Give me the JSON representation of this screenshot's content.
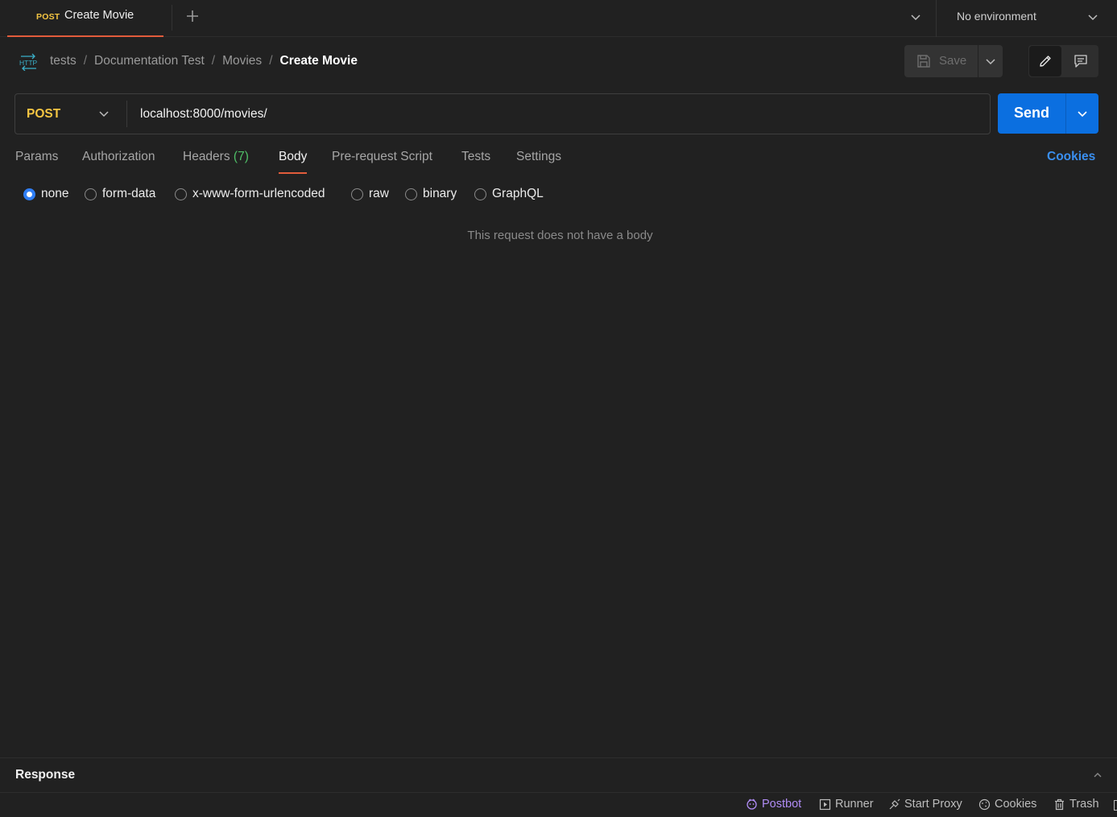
{
  "tab": {
    "method": "POST",
    "title": "Create Movie"
  },
  "environment": {
    "label": "No environment"
  },
  "breadcrumb": {
    "icon_label": "HTTP",
    "items": [
      "tests",
      "Documentation Test",
      "Movies"
    ],
    "current": "Create Movie"
  },
  "toolbar": {
    "save_label": "Save"
  },
  "request": {
    "method": "POST",
    "url": "localhost:8000/movies/",
    "send_label": "Send"
  },
  "request_tabs": {
    "params": "Params",
    "authorization": "Authorization",
    "headers": "Headers",
    "headers_count": "(7)",
    "body": "Body",
    "pre_request": "Pre-request Script",
    "tests": "Tests",
    "settings": "Settings",
    "active": "Body",
    "cookies": "Cookies"
  },
  "body_options": {
    "none": "none",
    "form_data": "form-data",
    "urlencoded": "x-www-form-urlencoded",
    "raw": "raw",
    "binary": "binary",
    "graphql": "GraphQL",
    "selected": "none"
  },
  "body": {
    "empty_message": "This request does not have a body"
  },
  "response": {
    "title": "Response"
  },
  "status_bar": {
    "postbot": "Postbot",
    "runner": "Runner",
    "start_proxy": "Start Proxy",
    "cookies": "Cookies",
    "trash": "Trash"
  },
  "colors": {
    "background": "#212121",
    "accent_send": "#0b6fe0",
    "method_post": "#f5c542",
    "tab_underline": "#e25c3b",
    "headers_count": "#4fbf67",
    "link": "#3a8ff0",
    "postbot": "#b08cf5"
  },
  "icons": {
    "new_tab": "plus-icon",
    "dropdown": "chevron-down-icon",
    "http": "http-icon",
    "save": "save-icon",
    "edit": "pencil-icon",
    "comment": "comment-icon",
    "response_toggle": "chevron-up-icon"
  }
}
